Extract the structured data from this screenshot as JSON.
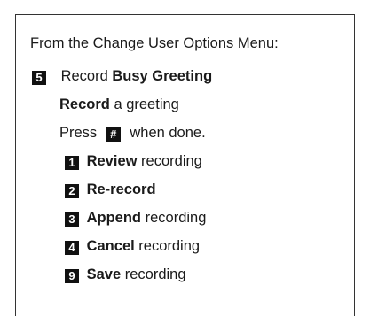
{
  "intro": "From the Change User Options Menu:",
  "step": {
    "key": "5",
    "pre": "Record ",
    "bold": "Busy Greeting"
  },
  "instruction": {
    "bold": "Record",
    "rest": " a greeting"
  },
  "press": {
    "pre": "Press ",
    "key": "#",
    "post": " when done."
  },
  "options": [
    {
      "key": "1",
      "bold": "Review",
      "rest": " recording"
    },
    {
      "key": "2",
      "bold": "Re-record",
      "rest": ""
    },
    {
      "key": "3",
      "bold": "Append",
      "rest": " recording"
    },
    {
      "key": "4",
      "bold": "Cancel",
      "rest": " recording"
    },
    {
      "key": "9",
      "bold": "Save",
      "rest": " recording"
    }
  ]
}
